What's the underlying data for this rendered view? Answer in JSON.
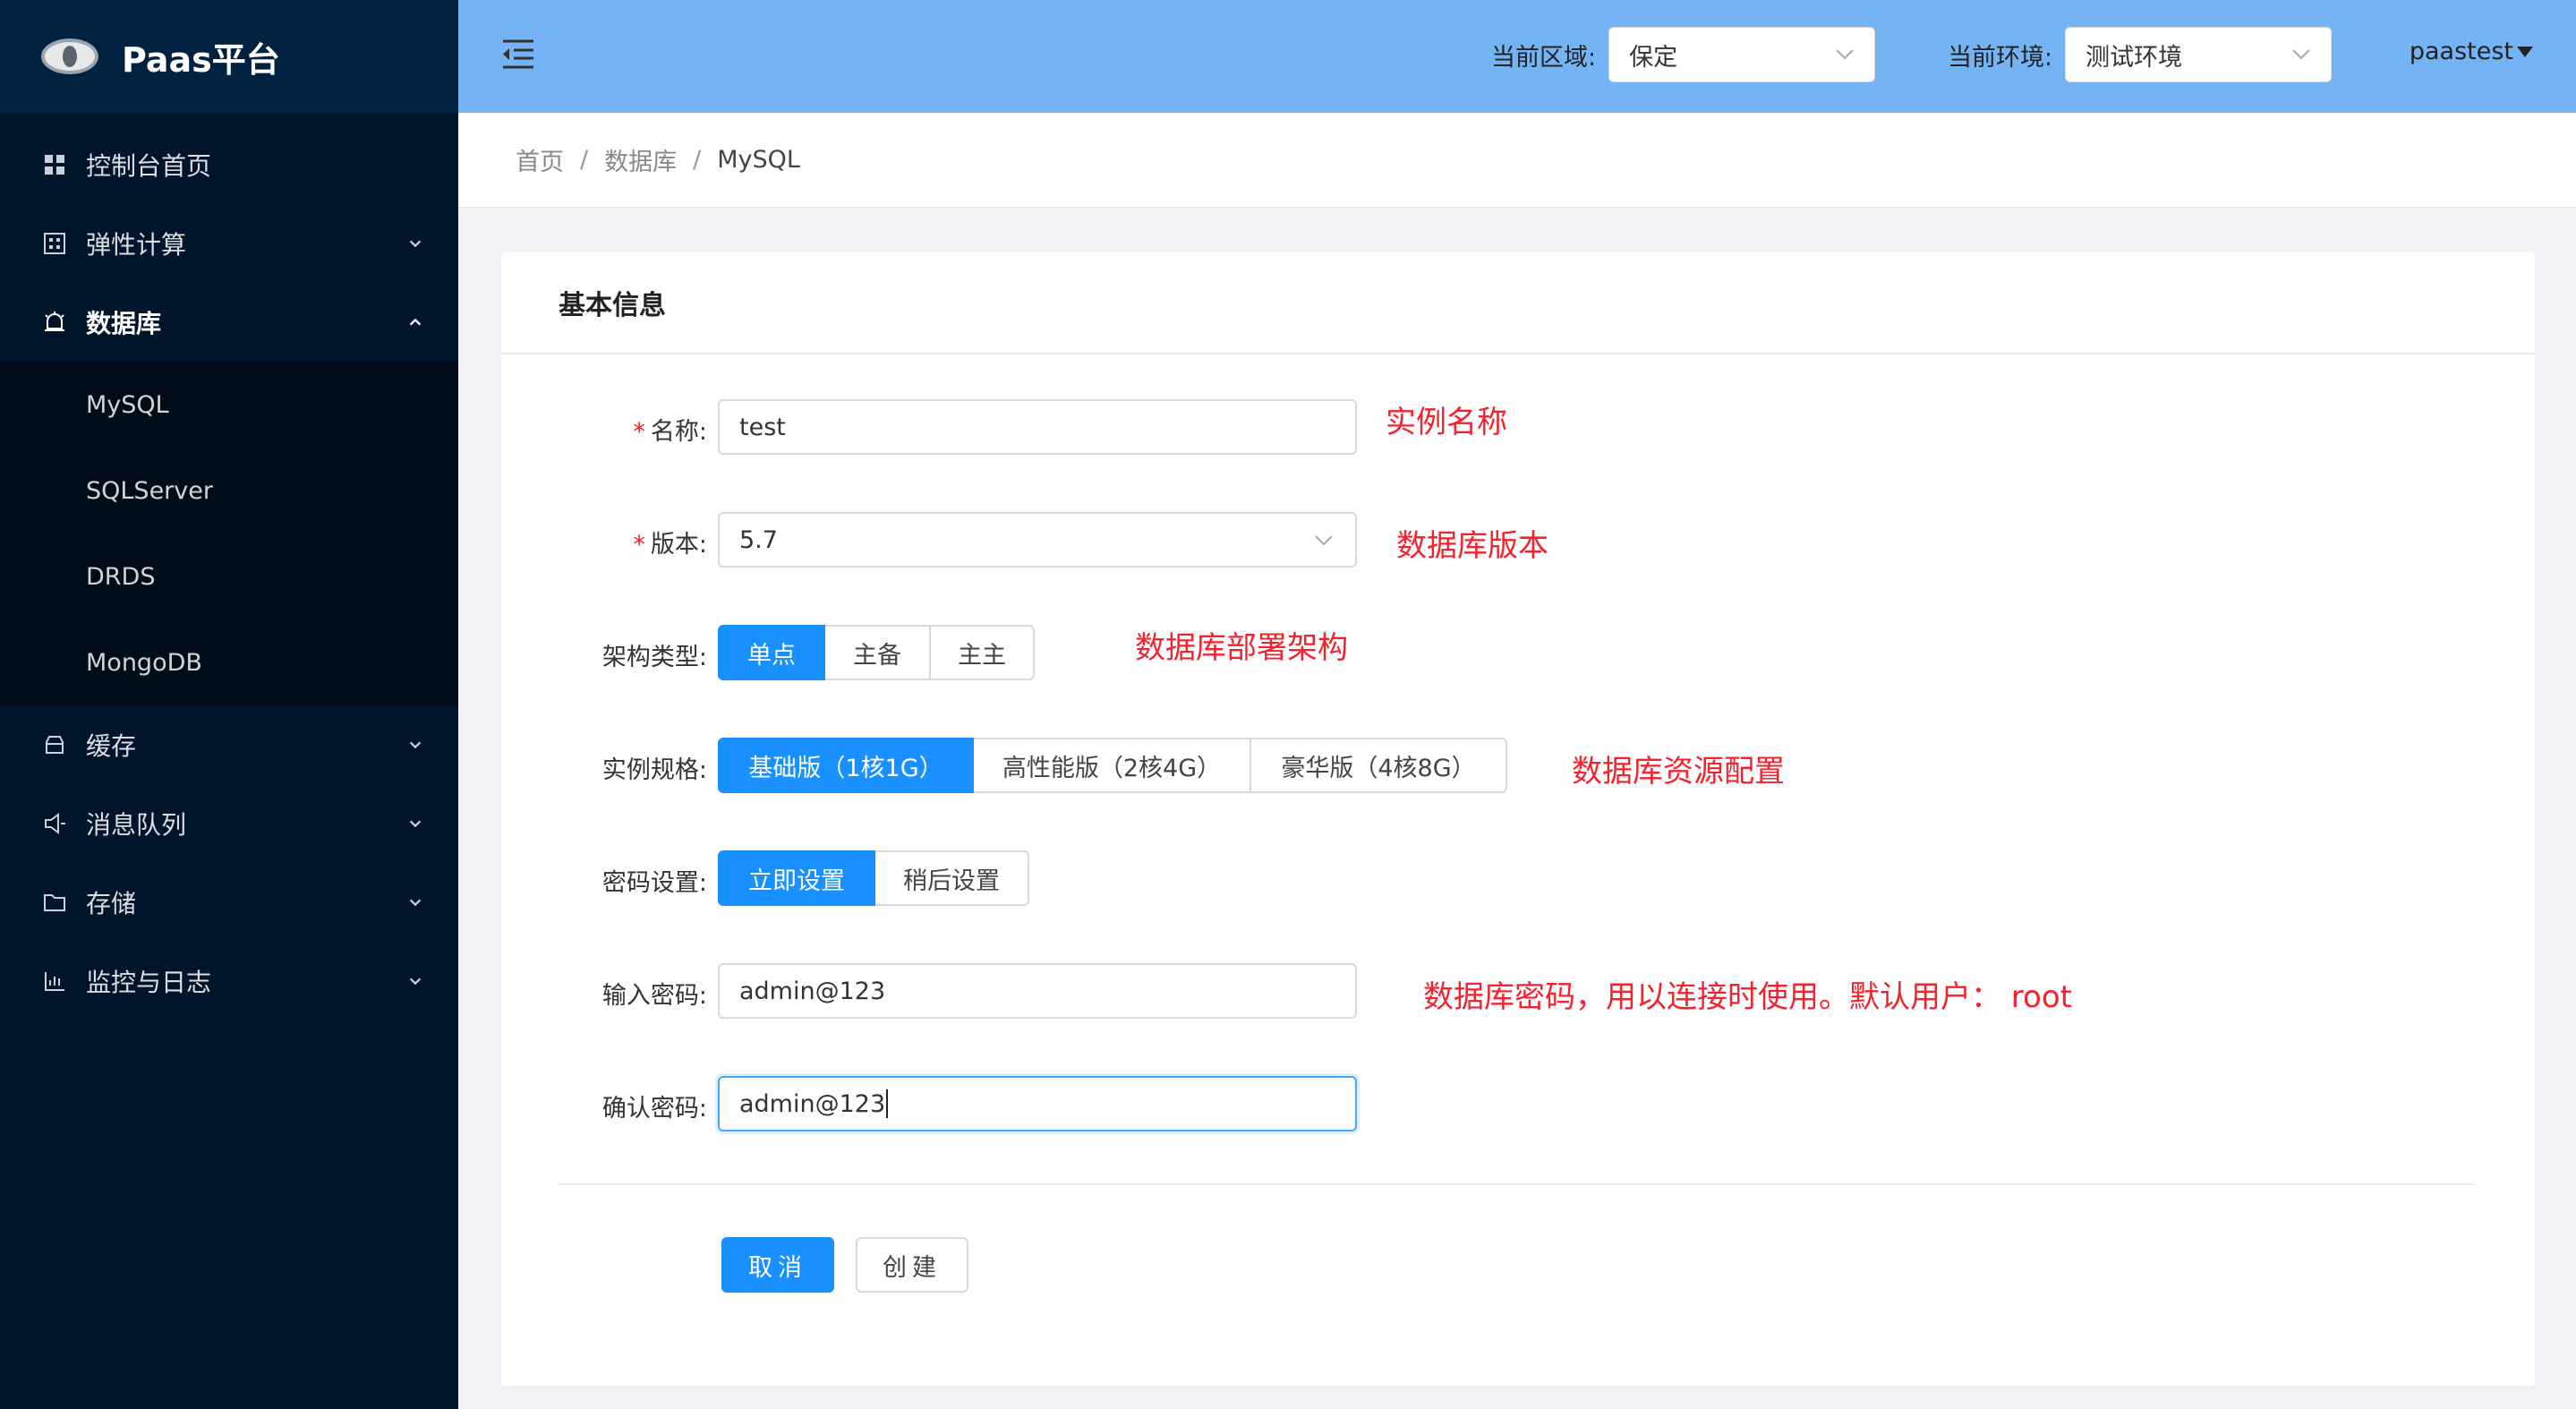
{
  "app": {
    "title": "Paas平台"
  },
  "sidebar": {
    "items": [
      {
        "label": "控制台首页",
        "icon": "dashboard-icon"
      },
      {
        "label": "弹性计算",
        "icon": "compute-icon"
      },
      {
        "label": "数据库",
        "icon": "database-icon",
        "expanded": true,
        "children": [
          "MySQL",
          "SQLServer",
          "DRDS",
          "MongoDB"
        ]
      },
      {
        "label": "缓存",
        "icon": "cache-icon"
      },
      {
        "label": "消息队列",
        "icon": "message-queue-icon"
      },
      {
        "label": "存储",
        "icon": "folder-icon"
      },
      {
        "label": "监控与日志",
        "icon": "chart-icon"
      }
    ]
  },
  "header": {
    "region_label": "当前区域:",
    "region_value": "保定",
    "env_label": "当前环境:",
    "env_value": "测试环境",
    "user": "paastest"
  },
  "breadcrumb": {
    "home": "首页",
    "section": "数据库",
    "current": "MySQL",
    "separator": "/"
  },
  "form": {
    "card_title": "基本信息",
    "name": {
      "label": "名称:",
      "value": "test",
      "note": "实例名称"
    },
    "version": {
      "label": "版本:",
      "value": "5.7",
      "note": "数据库版本"
    },
    "arch": {
      "label": "架构类型:",
      "options": [
        "单点",
        "主备",
        "主主"
      ],
      "selected": "单点",
      "note": "数据库部署架构"
    },
    "spec": {
      "label": "实例规格:",
      "options": [
        "基础版（1核1G）",
        "高性能版（2核4G）",
        "豪华版（4核8G）"
      ],
      "selected": "基础版（1核1G）",
      "note": "数据库资源配置"
    },
    "password_setting": {
      "label": "密码设置:",
      "options": [
        "立即设置",
        "稍后设置"
      ],
      "selected": "立即设置"
    },
    "password": {
      "label": "输入密码:",
      "value": "admin@123",
      "note": "数据库密码，用以连接时使用。默认用户： root"
    },
    "confirm_password": {
      "label": "确认密码:",
      "value": "admin@123"
    },
    "required_mark": "*",
    "cancel_label": "取消",
    "create_label": "创建"
  },
  "colors": {
    "primary": "#1890ff",
    "sidebar_bg": "#001529",
    "header_bg": "#74b4f5",
    "note_red": "#f5222d"
  }
}
